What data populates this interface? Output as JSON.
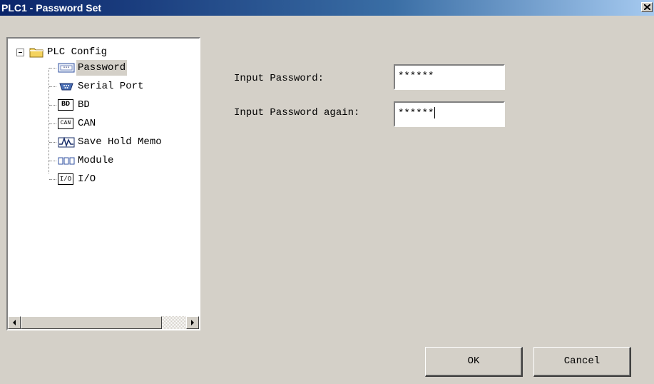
{
  "window": {
    "title": "PLC1 - Password Set"
  },
  "tree": {
    "root": {
      "label": "PLC Config",
      "icon": "folder-icon",
      "expanded": true
    },
    "items": [
      {
        "label": "Password",
        "icon": "password-icon",
        "selected": true
      },
      {
        "label": "Serial Port",
        "icon": "serial-port-icon",
        "selected": false
      },
      {
        "label": "BD",
        "icon": "bd-icon",
        "icon_text": "BD",
        "selected": false
      },
      {
        "label": "CAN",
        "icon": "can-icon",
        "icon_text": "CAN",
        "selected": false
      },
      {
        "label": "Save Hold Memo",
        "icon": "waveform-icon",
        "selected": false
      },
      {
        "label": "Module",
        "icon": "module-icon",
        "selected": false
      },
      {
        "label": "I/O",
        "icon": "io-icon",
        "icon_text": "I/O",
        "selected": false
      }
    ]
  },
  "form": {
    "password_label": "Input Password:",
    "password_value": "******",
    "password_again_label": "Input Password again:",
    "password_again_value": "******"
  },
  "buttons": {
    "ok": "OK",
    "cancel": "Cancel"
  },
  "colors": {
    "titlebar_start": "#0a246a",
    "titlebar_end": "#a6caf0",
    "face": "#d4d0c8"
  }
}
